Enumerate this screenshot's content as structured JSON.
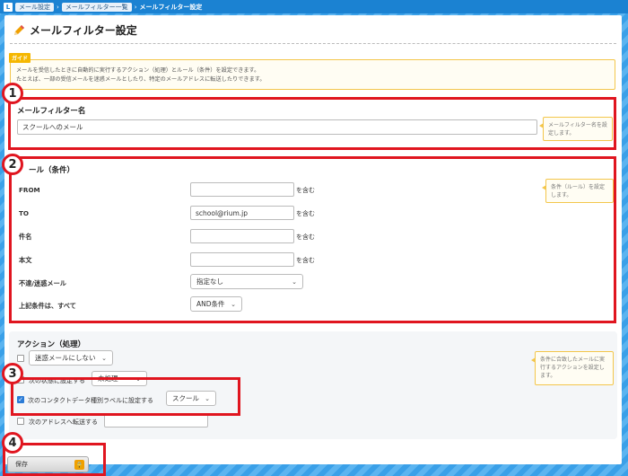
{
  "breadcrumb": {
    "home": "L",
    "items": [
      "メール設定",
      "メールフィルター一覧"
    ],
    "current": "メールフィルター設定"
  },
  "page": {
    "title": "メールフィルター設定",
    "title_icon": "pencil-icon"
  },
  "guide": {
    "tag": "ガイド",
    "line1": "メールを受信したときに自動的に実行するアクション（処理）とルール（条件）を設定できます。",
    "line2": "たとえば、一部の受信メールを迷惑メールとしたり、特定のメールアドレスに転送したりできます。"
  },
  "filter_name": {
    "label": "メールフィルター名",
    "value": "スクールへのメール",
    "note": "メールフィルター名を設定します。"
  },
  "rules": {
    "title": "ール（条件）",
    "note": "条件（ルール）を設定します。",
    "fields": [
      {
        "label": "FROM",
        "value": "",
        "suffix": "を含む"
      },
      {
        "label": "TO",
        "value": "school@rium.jp",
        "suffix": "を含む"
      },
      {
        "label": "件名",
        "value": "",
        "suffix": "を含む"
      },
      {
        "label": "本文",
        "value": "",
        "suffix": "を含む"
      }
    ],
    "spam_label": "不達/迷惑メール",
    "spam_value": "指定なし",
    "combine_label": "上記条件は、すべて",
    "combine_value": "AND条件"
  },
  "actions": {
    "title": "アクション（処理）",
    "note": "条件に合致したメールに実行するアクションを設定します。",
    "spam_select": "迷惑メールにしない",
    "status_text": "次の状態に設定する",
    "status_select": "未処理",
    "label_text": "次のコンタクトデータ種別ラベルに設定する",
    "label_select": "スクール",
    "forward_text": "次のアドレスへ転送する",
    "forward_value": ""
  },
  "markers": [
    "1",
    "2",
    "3",
    "4"
  ],
  "save": {
    "label": "保存"
  },
  "colors": {
    "accent": "#1b82d2",
    "highlight": "#e0151f",
    "guide_border": "#f3c64b"
  }
}
